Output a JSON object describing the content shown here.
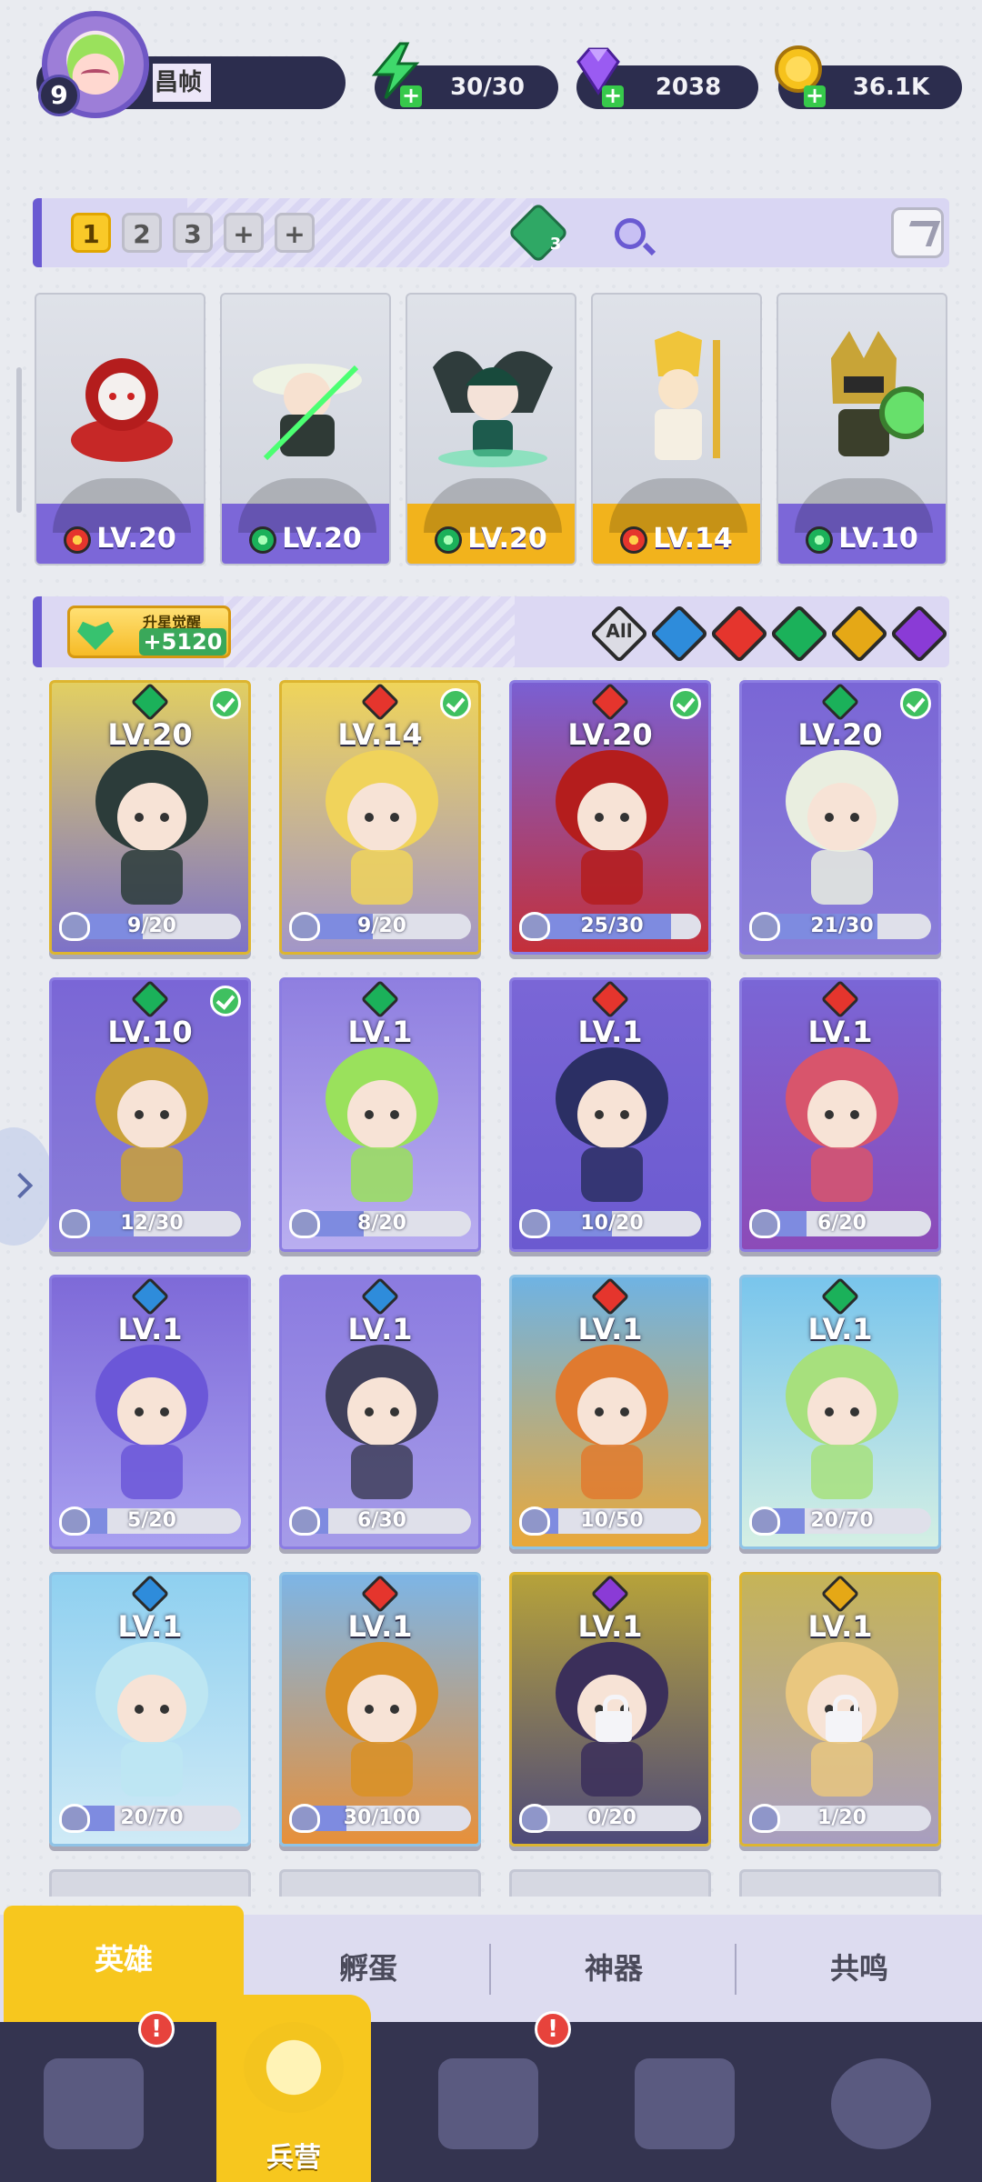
{
  "player": {
    "level": "9",
    "name": "昌帧"
  },
  "resources": [
    {
      "name": "energy",
      "icon": "lightning-icon",
      "value": "30/30"
    },
    {
      "name": "diamonds",
      "icon": "diamond-icon",
      "value": "2038"
    },
    {
      "name": "coins",
      "icon": "coin-icon",
      "value": "36.1K"
    }
  ],
  "team": {
    "slots": [
      "1",
      "2",
      "3",
      "+",
      "+"
    ],
    "active_slot": "1",
    "gem_count": "3",
    "members": [
      {
        "element": "fire",
        "level": "LV.20"
      },
      {
        "element": "wind",
        "level": "LV.20"
      },
      {
        "element": "wind",
        "level": "LV.20"
      },
      {
        "element": "fire",
        "level": "LV.14"
      },
      {
        "element": "wind",
        "level": "LV.10"
      }
    ]
  },
  "awaken": {
    "label": "升星觉醒",
    "value": "+5120"
  },
  "filters": {
    "all_label": "All",
    "elements": [
      "water",
      "fire",
      "wind",
      "light",
      "dark"
    ]
  },
  "heroes": [
    {
      "element": "wind",
      "level": "LV.20",
      "progress": "9/20",
      "fraction": 0.45,
      "in_team": true,
      "locked": false
    },
    {
      "element": "fire",
      "level": "LV.14",
      "progress": "9/20",
      "fraction": 0.45,
      "in_team": true,
      "locked": false
    },
    {
      "element": "fire",
      "level": "LV.20",
      "progress": "25/30",
      "fraction": 0.83,
      "in_team": true,
      "locked": false
    },
    {
      "element": "wind",
      "level": "LV.20",
      "progress": "21/30",
      "fraction": 0.7,
      "in_team": true,
      "locked": false
    },
    {
      "element": "wind",
      "level": "LV.10",
      "progress": "12/30",
      "fraction": 0.4,
      "in_team": true,
      "locked": false
    },
    {
      "element": "wind",
      "level": "LV.1",
      "progress": "8/20",
      "fraction": 0.4,
      "in_team": false,
      "locked": false
    },
    {
      "element": "fire",
      "level": "LV.1",
      "progress": "10/20",
      "fraction": 0.5,
      "in_team": false,
      "locked": false
    },
    {
      "element": "fire",
      "level": "LV.1",
      "progress": "6/20",
      "fraction": 0.3,
      "in_team": false,
      "locked": false
    },
    {
      "element": "water",
      "level": "LV.1",
      "progress": "5/20",
      "fraction": 0.25,
      "in_team": false,
      "locked": false
    },
    {
      "element": "water",
      "level": "LV.1",
      "progress": "6/30",
      "fraction": 0.2,
      "in_team": false,
      "locked": false
    },
    {
      "element": "fire",
      "level": "LV.1",
      "progress": "10/50",
      "fraction": 0.2,
      "in_team": false,
      "locked": false
    },
    {
      "element": "wind",
      "level": "LV.1",
      "progress": "20/70",
      "fraction": 0.29,
      "in_team": false,
      "locked": false
    },
    {
      "element": "water",
      "level": "LV.1",
      "progress": "20/70",
      "fraction": 0.29,
      "in_team": false,
      "locked": false
    },
    {
      "element": "fire",
      "level": "LV.1",
      "progress": "30/100",
      "fraction": 0.3,
      "in_team": false,
      "locked": false
    },
    {
      "element": "dark",
      "level": "LV.1",
      "progress": "0/20",
      "fraction": 0.0,
      "in_team": false,
      "locked": true
    },
    {
      "element": "light",
      "level": "LV.1",
      "progress": "1/20",
      "fraction": 0.05,
      "in_team": false,
      "locked": true
    }
  ],
  "subtabs": [
    "英雄",
    "孵蛋",
    "神器",
    "共鸣"
  ],
  "nav": {
    "items": [
      {
        "name": "cards",
        "icon": "cards-icon",
        "label": "",
        "alert": "!"
      },
      {
        "name": "barracks",
        "icon": "barracks-icon",
        "label": "兵营",
        "alert": ""
      },
      {
        "name": "map",
        "icon": "map-icon",
        "label": "",
        "alert": "!"
      },
      {
        "name": "castle",
        "icon": "castle-icon",
        "label": "",
        "alert": ""
      },
      {
        "name": "mushroom",
        "icon": "mushroom-icon",
        "label": "",
        "alert": ""
      }
    ]
  },
  "colors": {
    "accent": "#6a5ad2",
    "gold": "#f7c71e",
    "fire": "#e5352d",
    "wind": "#1bb15a",
    "water": "#2e8cdb",
    "light": "#e5a816",
    "dark": "#8a3bd6"
  }
}
